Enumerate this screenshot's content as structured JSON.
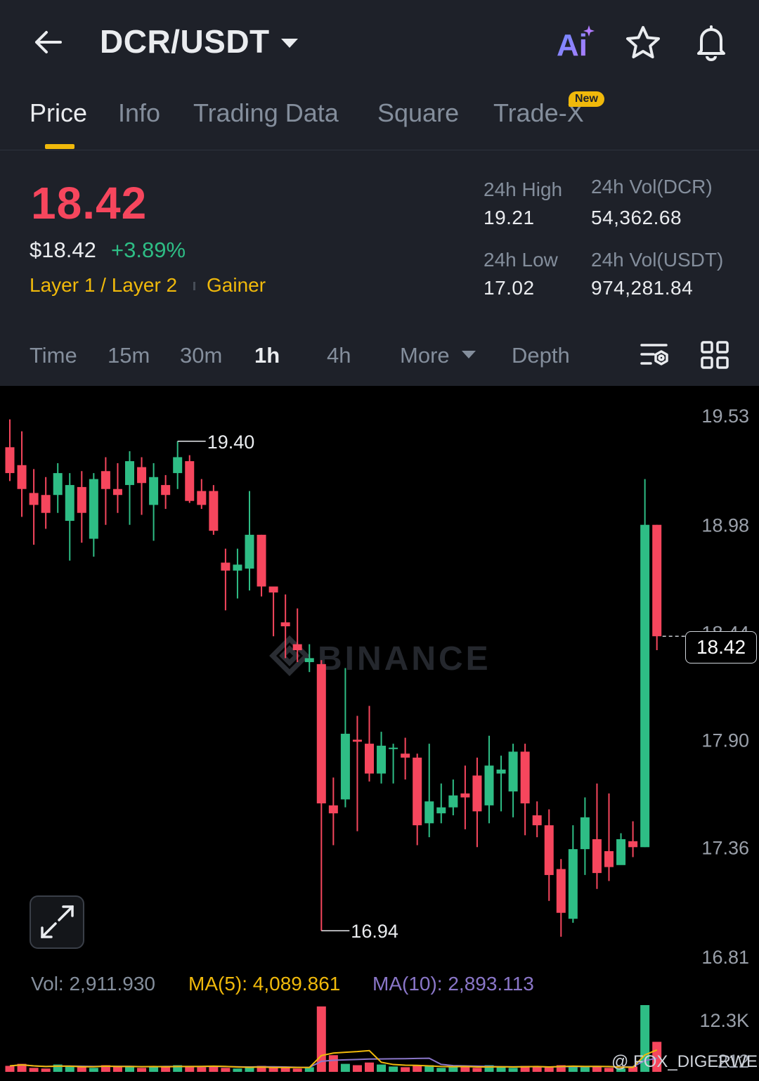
{
  "header": {
    "pair": "DCR/USDT",
    "ai_label": "Ai"
  },
  "tabs": [
    {
      "label": "Price",
      "active": true
    },
    {
      "label": "Info"
    },
    {
      "label": "Trading Data"
    },
    {
      "label": "Square"
    },
    {
      "label": "Trade-X",
      "badge": "New"
    }
  ],
  "price": {
    "last": "18.42",
    "usd": "$18.42",
    "change": "+3.89%",
    "tag_category": "Layer 1 / Layer 2",
    "tag_status": "Gainer",
    "high_label": "24h High",
    "high_value": "19.21",
    "low_label": "24h Low",
    "low_value": "17.02",
    "vol_base_label": "24h Vol(DCR)",
    "vol_base_value": "54,362.68",
    "vol_quote_label": "24h Vol(USDT)",
    "vol_quote_value": "974,281.84"
  },
  "intervals": {
    "time": "Time",
    "m15": "15m",
    "m30": "30m",
    "h1": "1h",
    "h4": "4h",
    "more": "More",
    "depth": "Depth",
    "active": "1h"
  },
  "colors": {
    "up": "#2ebd85",
    "down": "#f6465d",
    "accent": "#f0b90b",
    "ma5": "#f0b90b",
    "ma10": "#8a76c8",
    "bg": "#1e2129",
    "chart_bg": "#000000"
  },
  "indicators": {
    "vol": "Vol: 2,911.930",
    "ma5": "MA(5): 4,089.861",
    "ma10": "MA(10): 2,893.113"
  },
  "watermark": {
    "brand": "BINANCE",
    "credit": "@ FOX_DIGERWEB"
  },
  "chart_data": {
    "type": "candlestick",
    "interval": "1h",
    "y_ticks": [
      19.53,
      18.98,
      18.44,
      17.9,
      17.36,
      16.81
    ],
    "y_tick_labels": [
      "19.53",
      "18.98",
      "18.44",
      "17.90",
      "17.36",
      "16.81"
    ],
    "ylim": [
      16.81,
      19.53
    ],
    "current_price": "18.42",
    "high_marker": "19.40",
    "low_marker": "16.94",
    "volume_ticks": [
      "12.3K",
      "212"
    ],
    "candles": [
      [
        19.37,
        19.24,
        19.51,
        19.2
      ],
      [
        19.28,
        19.16,
        19.45,
        19.02
      ],
      [
        19.14,
        19.08,
        19.26,
        18.88
      ],
      [
        19.13,
        19.04,
        19.22,
        18.96
      ],
      [
        19.13,
        19.24,
        19.29,
        19.04
      ],
      [
        19.0,
        19.18,
        19.24,
        18.8
      ],
      [
        19.17,
        19.04,
        19.25,
        18.89
      ],
      [
        18.91,
        19.21,
        19.24,
        18.82
      ],
      [
        19.25,
        19.16,
        19.32,
        18.98
      ],
      [
        19.16,
        19.13,
        19.29,
        19.04
      ],
      [
        19.18,
        19.3,
        19.35,
        18.98
      ],
      [
        19.27,
        19.19,
        19.32,
        19.03
      ],
      [
        19.08,
        19.22,
        19.29,
        18.9
      ],
      [
        19.18,
        19.13,
        19.23,
        19.06
      ],
      [
        19.24,
        19.32,
        19.4,
        19.16
      ],
      [
        19.3,
        19.1,
        19.33,
        19.09
      ],
      [
        19.15,
        19.08,
        19.21,
        19.06
      ],
      [
        19.15,
        18.95,
        19.18,
        18.93
      ],
      [
        18.79,
        18.75,
        18.86,
        18.55
      ],
      [
        18.75,
        18.78,
        18.86,
        18.61
      ],
      [
        18.76,
        18.93,
        19.15,
        18.65
      ],
      [
        18.93,
        18.67,
        18.93,
        18.62
      ],
      [
        18.67,
        18.64,
        18.67,
        18.42
      ],
      [
        18.49,
        18.47,
        18.63,
        18.31
      ],
      [
        18.38,
        18.35,
        18.56,
        18.29
      ],
      [
        18.29,
        18.31,
        18.38,
        18.24
      ],
      [
        18.28,
        17.58,
        18.3,
        16.94
      ],
      [
        17.57,
        17.53,
        17.71,
        17.37
      ],
      [
        17.6,
        17.93,
        18.26,
        17.56
      ],
      [
        17.9,
        17.89,
        18.02,
        17.44
      ],
      [
        17.88,
        17.73,
        18.07,
        17.69
      ],
      [
        17.73,
        17.87,
        17.94,
        17.68
      ],
      [
        17.86,
        17.86,
        17.88,
        17.68
      ],
      [
        17.83,
        17.81,
        17.91,
        17.7
      ],
      [
        17.81,
        17.47,
        17.83,
        17.37
      ],
      [
        17.48,
        17.59,
        17.88,
        17.41
      ],
      [
        17.53,
        17.56,
        17.68,
        17.48
      ],
      [
        17.56,
        17.62,
        17.7,
        17.52
      ],
      [
        17.63,
        17.61,
        17.77,
        17.45
      ],
      [
        17.72,
        17.54,
        17.81,
        17.36
      ],
      [
        17.57,
        17.77,
        17.92,
        17.48
      ],
      [
        17.73,
        17.75,
        17.82,
        17.54
      ],
      [
        17.64,
        17.84,
        17.88,
        17.51
      ],
      [
        17.84,
        17.58,
        17.88,
        17.42
      ],
      [
        17.52,
        17.47,
        17.59,
        17.41
      ],
      [
        17.47,
        17.22,
        17.55,
        17.09
      ],
      [
        17.25,
        17.03,
        17.3,
        16.91
      ],
      [
        17.0,
        17.35,
        17.47,
        16.98
      ],
      [
        17.35,
        17.51,
        17.61,
        17.22
      ],
      [
        17.4,
        17.23,
        17.68,
        17.15
      ],
      [
        17.34,
        17.26,
        17.63,
        17.19
      ],
      [
        17.27,
        17.4,
        17.43,
        17.4
      ],
      [
        17.39,
        17.36,
        17.49,
        17.31
      ],
      [
        17.36,
        18.98,
        19.21,
        17.36
      ],
      [
        18.98,
        18.42,
        18.98,
        18.35
      ]
    ],
    "volumes": [
      0.09,
      0.12,
      0.06,
      0.05,
      0.11,
      0.09,
      0.07,
      0.06,
      0.1,
      0.08,
      0.09,
      0.06,
      0.07,
      0.08,
      0.1,
      0.09,
      0.07,
      0.09,
      0.06,
      0.05,
      0.07,
      0.09,
      0.06,
      0.06,
      0.05,
      0.07,
      0.98,
      0.25,
      0.12,
      0.1,
      0.14,
      0.11,
      0.08,
      0.07,
      0.09,
      0.1,
      0.06,
      0.07,
      0.08,
      0.06,
      0.1,
      0.07,
      0.06,
      0.09,
      0.08,
      0.07,
      0.1,
      0.09,
      0.07,
      0.08,
      0.06,
      0.05,
      0.08,
      1.0,
      0.45
    ]
  }
}
